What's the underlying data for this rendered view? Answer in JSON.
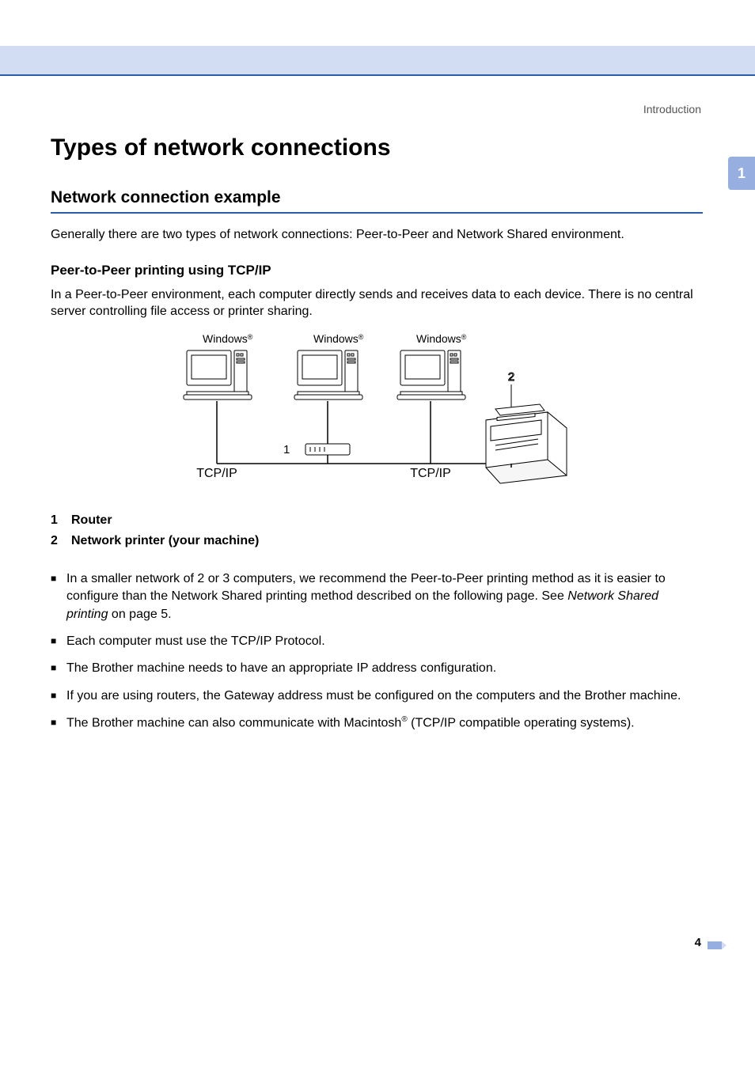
{
  "header": {
    "section": "Introduction"
  },
  "chapter_tab": "1",
  "title": "Types of network connections",
  "h2": "Network connection example",
  "intro": "Generally there are two types of network connections: Peer-to-Peer and Network Shared environment.",
  "h3": "Peer-to-Peer printing using TCP/IP",
  "sub_intro": "In a Peer-to-Peer environment, each computer directly sends and receives data to each device. There is no central server controlling file access or printer sharing.",
  "diagram": {
    "pc_labels": [
      "Windows",
      "Windows",
      "Windows"
    ],
    "reg": "®",
    "tcpip_left": "TCP/IP",
    "tcpip_right": "TCP/IP",
    "callout_1": "1",
    "callout_2": "2"
  },
  "legend": [
    {
      "num": "1",
      "text": "Router"
    },
    {
      "num": "2",
      "text": "Network printer (your machine)"
    }
  ],
  "bullets": [
    {
      "pre": "In a smaller network of 2 or 3 computers, we recommend the Peer-to-Peer printing method as it is easier to configure than the Network Shared printing method described on the following page. See ",
      "italic": "Network Shared printing",
      "post": " on page 5."
    },
    {
      "pre": "Each computer must use the TCP/IP Protocol.",
      "italic": "",
      "post": ""
    },
    {
      "pre": "The Brother machine needs to have an appropriate IP address configuration.",
      "italic": "",
      "post": ""
    },
    {
      "pre": "If you are using routers, the Gateway address must be configured on the computers and the Brother machine.",
      "italic": "",
      "post": ""
    },
    {
      "pre": "The Brother machine can also communicate with Macintosh",
      "sup": "®",
      "post2": " (TCP/IP compatible operating systems)."
    }
  ],
  "page_number": "4"
}
